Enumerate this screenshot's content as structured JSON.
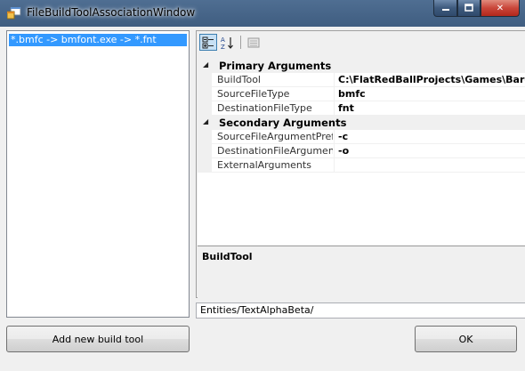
{
  "window": {
    "title": "FileBuildToolAssociationWindow",
    "close_glyph": "✕"
  },
  "list": {
    "items": [
      {
        "label": "*.bmfc -> bmfont.exe -> *.fnt",
        "selected": true
      }
    ]
  },
  "property_grid": {
    "categories": [
      {
        "name": "Primary Arguments",
        "properties": [
          {
            "name": "BuildTool",
            "value": "C:\\FlatRedBallProjects\\Games\\Baro"
          },
          {
            "name": "SourceFileType",
            "value": "bmfc"
          },
          {
            "name": "DestinationFileType",
            "value": "fnt"
          }
        ]
      },
      {
        "name": "Secondary Arguments",
        "properties": [
          {
            "name": "SourceFileArgumentPrefix",
            "value": "-c"
          },
          {
            "name": "DestinationFileArgumentPre",
            "value": "-o"
          },
          {
            "name": "ExternalArguments",
            "value": ""
          }
        ]
      }
    ],
    "help_title": "BuildTool"
  },
  "path_field": {
    "value": "Entities/TextAlphaBeta/"
  },
  "buttons": {
    "add_label": "Add new build tool",
    "ok_label": "OK"
  },
  "colors": {
    "selection": "#3399ff",
    "titlebar": "#3f5d80",
    "close_button": "#c9463a"
  }
}
